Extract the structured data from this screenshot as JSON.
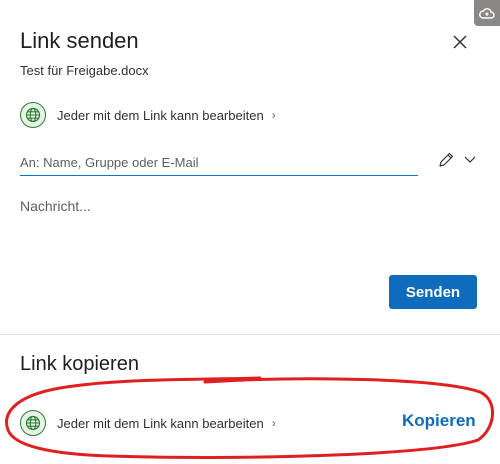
{
  "header": {
    "title": "Link senden",
    "file_name": "Test für Freigabe.docx"
  },
  "send_section": {
    "permission_label": "Jeder mit dem Link kann bearbeiten",
    "to_placeholder": "An: Name, Gruppe oder E-Mail",
    "to_value": "",
    "message_placeholder": "Nachricht...",
    "message_value": "",
    "send_label": "Senden"
  },
  "copy_section": {
    "title": "Link kopieren",
    "permission_label": "Jeder mit dem Link kann bearbeiten",
    "copy_label": "Kopieren"
  },
  "icons": {
    "globe": "globe-icon",
    "chevron_right": "›",
    "close": "close-icon",
    "pencil": "pencil-icon",
    "chevron_down": "chevron-down-icon",
    "cloud": "cloud-icon"
  },
  "colors": {
    "accent": "#0f6cbd",
    "globe_green": "#2e7d32",
    "annotation_red": "#e02020"
  }
}
